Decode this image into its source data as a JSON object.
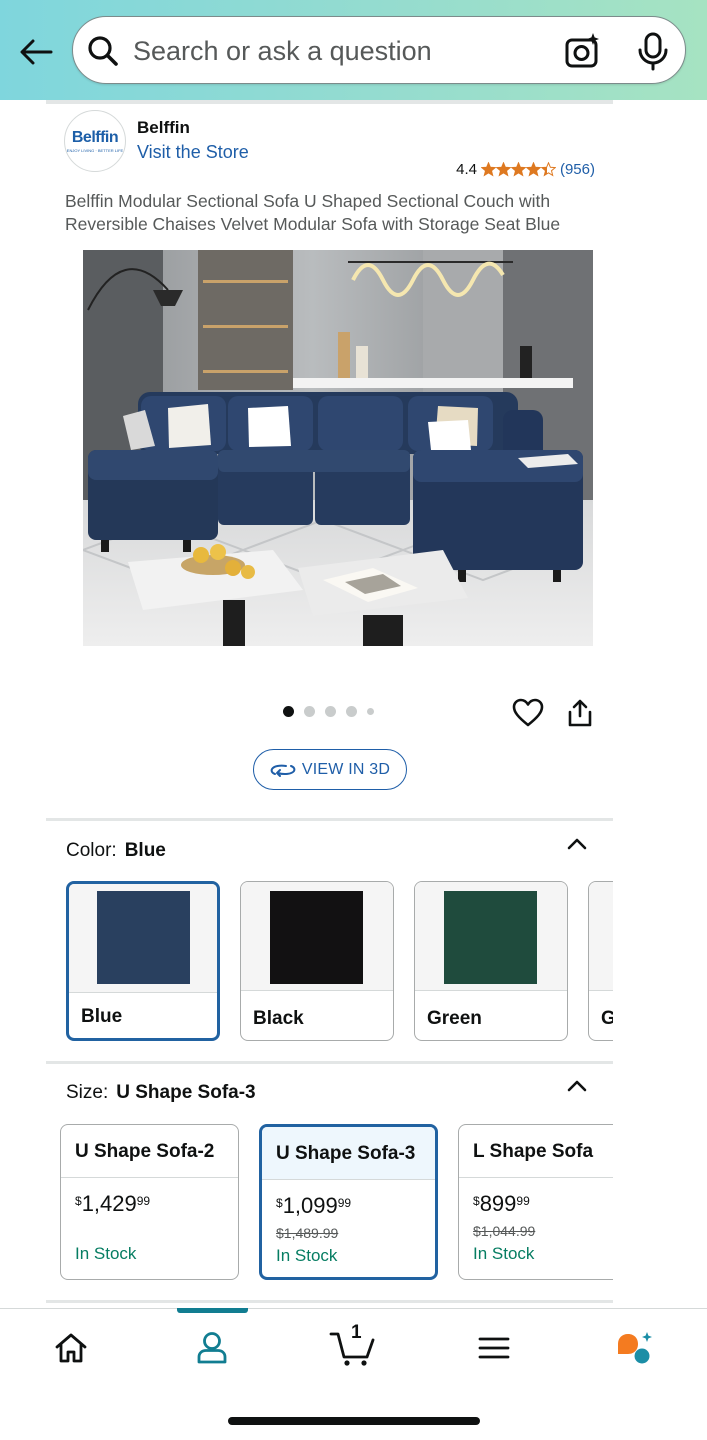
{
  "header": {
    "search_placeholder": "Search or ask a question"
  },
  "brand": {
    "logo_text": "Belffin",
    "logo_tagline": "ENJOY LIVING · BETTER LIFE",
    "name": "Belffin",
    "store_link": "Visit the Store"
  },
  "rating": {
    "value": "4.4",
    "stars": 4.4,
    "count": "(956)"
  },
  "product": {
    "title": "Belffin Modular Sectional Sofa U Shaped Sectional Couch with Reversible Chaises Velvet Modular Sofa with Storage Seat Blue",
    "image_description_icon": "sofa-photo",
    "carousel_pages": 5,
    "carousel_active": 1
  },
  "view3d": {
    "label": "VIEW IN 3D"
  },
  "color_section": {
    "label": "Color:",
    "selected": "Blue",
    "options": [
      {
        "label": "Blue",
        "swatch": "#29405f",
        "selected": true
      },
      {
        "label": "Black",
        "swatch": "#121112",
        "selected": false
      },
      {
        "label": "Green",
        "swatch": "#1f4b3d",
        "selected": false
      },
      {
        "label": "G",
        "swatch": "#f5f5f5",
        "selected": false
      }
    ]
  },
  "size_section": {
    "label": "Size:",
    "selected": "U Shape Sofa-3",
    "options": [
      {
        "name": "U Shape Sofa-2",
        "currency": "$",
        "price_whole": "1,429",
        "price_fraction": "99",
        "list_price": "",
        "stock": "In Stock",
        "selected": false
      },
      {
        "name": "U Shape Sofa-3",
        "currency": "$",
        "price_whole": "1,099",
        "price_fraction": "99",
        "list_price": "$1,489.99",
        "stock": "In Stock",
        "selected": true
      },
      {
        "name": "L Shape Sofa",
        "currency": "$",
        "price_whole": "899",
        "price_fraction": "99",
        "list_price": "$1,044.99",
        "stock": "In Stock",
        "selected": false
      }
    ]
  },
  "bottom_nav": {
    "items": [
      "home-icon",
      "account-icon",
      "cart-icon",
      "menu-icon",
      "rufus-icon"
    ],
    "active": "account-icon",
    "cart_count": "1"
  },
  "colors": {
    "header_start": "#7fd6dd",
    "header_end": "#a6e3c2",
    "link": "#1f5ea8",
    "selected_border": "#2162a1",
    "in_stock": "#067d62",
    "star": "#de7921",
    "nav_active": "#117d91",
    "rufus_orange": "#f47b20",
    "rufus_teal": "#1b8ea6"
  }
}
